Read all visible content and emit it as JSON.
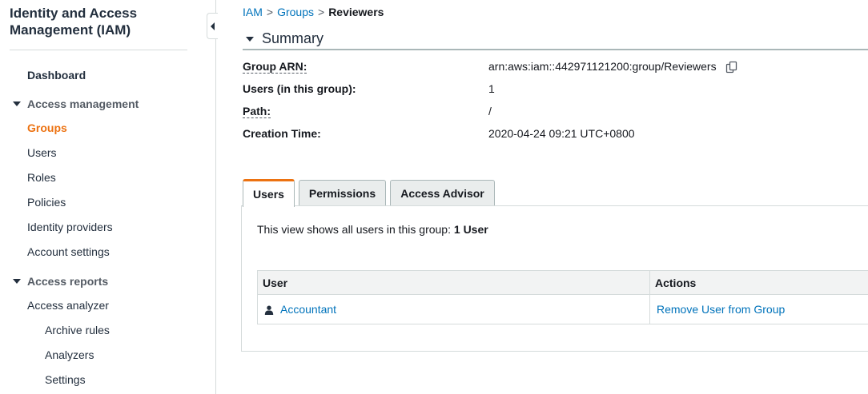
{
  "sidebar": {
    "title": "Identity and Access Management (IAM)",
    "dashboard": "Dashboard",
    "access_management": {
      "label": "Access management",
      "items": [
        "Groups",
        "Users",
        "Roles",
        "Policies",
        "Identity providers",
        "Account settings"
      ],
      "active": "Groups"
    },
    "access_reports": {
      "label": "Access reports",
      "items": [
        "Access analyzer"
      ],
      "subitems": [
        "Archive rules",
        "Analyzers",
        "Settings"
      ]
    }
  },
  "breadcrumb": {
    "items": [
      "IAM",
      "Groups"
    ],
    "separator": ">",
    "current": "Reviewers"
  },
  "summary": {
    "title": "Summary",
    "fields": [
      {
        "label": "Group ARN:",
        "value": "arn:aws:iam::442971121200:group/Reviewers"
      },
      {
        "label": "Users (in this group):",
        "value": "1"
      },
      {
        "label": "Path:",
        "value": "/"
      },
      {
        "label": "Creation Time:",
        "value": "2020-04-24 09:21 UTC+0800"
      }
    ]
  },
  "tabs": {
    "items": [
      "Users",
      "Permissions",
      "Access Advisor"
    ],
    "active": "Users"
  },
  "users_panel": {
    "description": "This view shows all users in this group:",
    "count_label": "1 User",
    "table": {
      "headers": [
        "User",
        "Actions"
      ],
      "rows": [
        {
          "user": "Accountant",
          "action": "Remove User from Group"
        }
      ]
    }
  },
  "colors": {
    "accent": "#ec7211",
    "link": "#0073bb",
    "text": "#16191f"
  }
}
